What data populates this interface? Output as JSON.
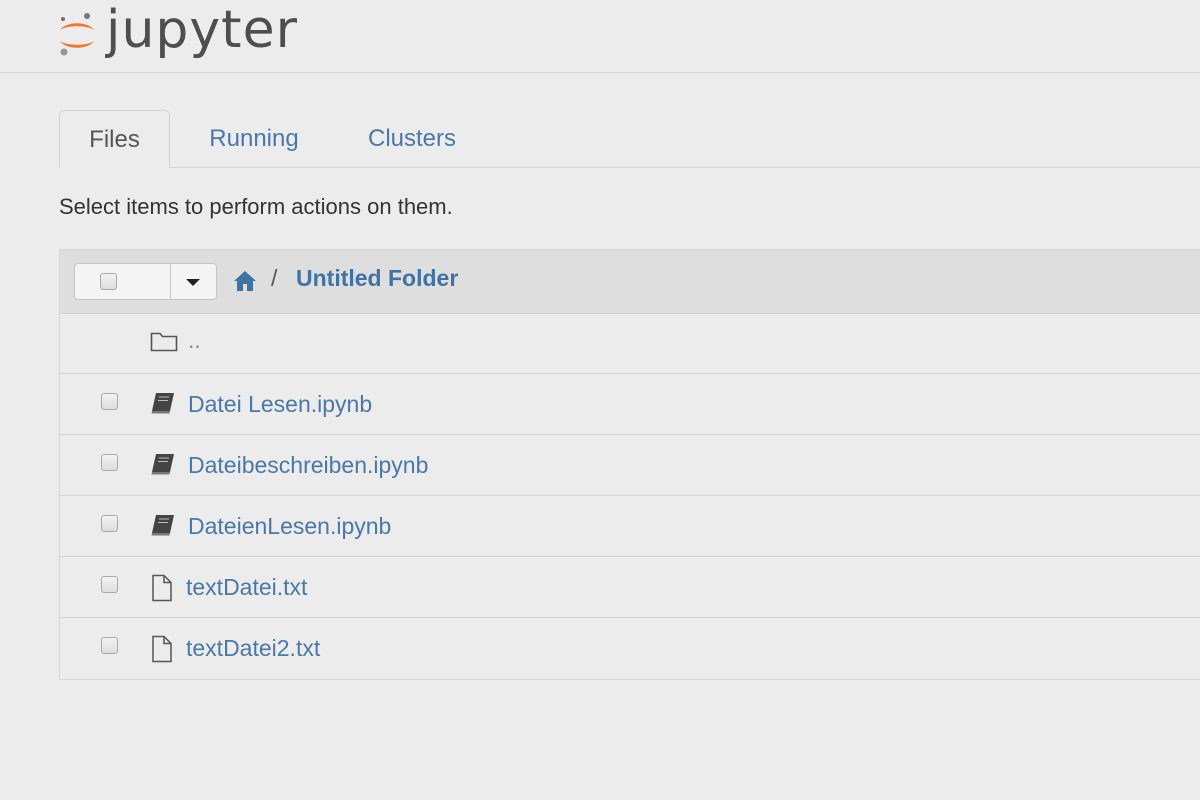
{
  "app": {
    "logo_text": "jupyter",
    "brand_color": "#f37726"
  },
  "tabs": [
    {
      "label": "Files",
      "active": true
    },
    {
      "label": "Running",
      "active": false
    },
    {
      "label": "Clusters",
      "active": false
    }
  ],
  "hint": "Select items to perform actions on them.",
  "breadcrumb": {
    "home_icon": "home-icon",
    "separator": "/",
    "folder": "Untitled Folder"
  },
  "items": [
    {
      "name": "..",
      "type": "parent",
      "icon": "folder-icon"
    },
    {
      "name": "Datei Lesen.ipynb",
      "type": "notebook",
      "icon": "notebook-icon"
    },
    {
      "name": "Dateibeschreiben.ipynb",
      "type": "notebook",
      "icon": "notebook-icon"
    },
    {
      "name": "DateienLesen.ipynb",
      "type": "notebook",
      "icon": "notebook-icon"
    },
    {
      "name": "textDatei.txt",
      "type": "file",
      "icon": "file-icon"
    },
    {
      "name": "textDatei2.txt",
      "type": "file",
      "icon": "file-icon"
    }
  ],
  "colors": {
    "link": "#4a78a8",
    "background": "#ececec",
    "panel_header": "#dedede"
  }
}
